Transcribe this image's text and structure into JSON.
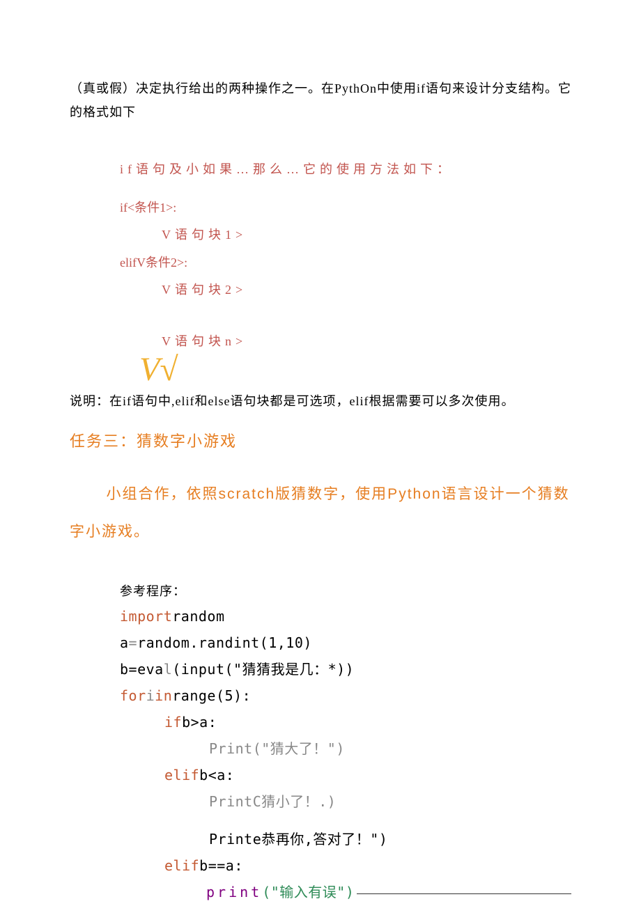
{
  "intro": {
    "para1": "（真或假）决定执行给出的两种操作之一。在PythOn中使用if语句来设计分支结构。它的格式如下"
  },
  "ifsyntax": {
    "line1": "if语句及小如果…那么…它的使用方法如下：",
    "if": "if<条件1>:",
    "blk1": "V语句块1>",
    "elif": "elifV条件2>:",
    "blk2": "V语句块2>",
    "blkn": "V语句块n>"
  },
  "vroot": "V√",
  "note": "说明：在if语句中,elif和else语句块都是可选项，elif根据需要可以多次使用。",
  "task": {
    "title": "任务三：猜数字小游戏",
    "body": "小组合作，依照scratch版猜数字，使用Python语言设计一个猜数字小游戏。"
  },
  "ref": "参考程序：",
  "code": {
    "l1a": "import",
    "l1b": "random",
    "l2a": "a",
    "l2b": "=",
    "l2c": "random.randint(1,10)",
    "l3a": "b=eva",
    "l3b": "l",
    "l3c": "(input(\"猜猜我是几：*))",
    "l4a": "for",
    "l4b": "i",
    "l4c": "in",
    "l4d": "range(5):",
    "l5a": "if",
    "l5b": "b>a:",
    "l6": "Print(\"猜大了！\")",
    "l7a": "elif",
    "l7b": "b<a:",
    "l8": "PrintC猜小了！.)",
    "l9": "Printe恭再你,答对了！\")",
    "l10a": "elif",
    "l10b": "b==a:",
    "l11a": "print",
    "l11b": "(\"输入有误\")"
  }
}
